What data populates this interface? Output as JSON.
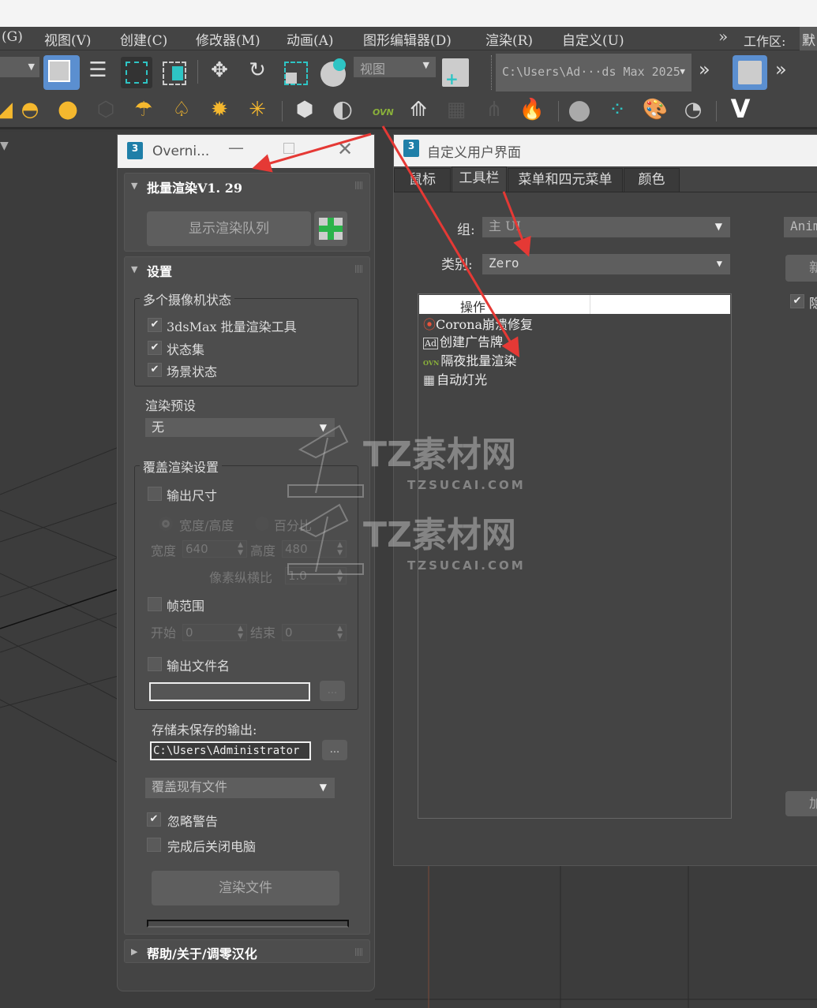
{
  "menubar": {
    "items": [
      "(G)",
      "视图(V)",
      "创建(C)",
      "修改器(M)",
      "动画(A)",
      "图形编辑器(D)",
      "渲染(R)",
      "自定义(U)"
    ],
    "overflow": "»",
    "workspace_label": "工作区:",
    "workspace_value": "默"
  },
  "toolbar": {
    "view_dropdown": "视图",
    "path_dropdown": "C:\\Users\\Ad···ds Max 2025",
    "overflow": "»",
    "ovn_label": "OVN"
  },
  "overnight": {
    "title": "Overni...",
    "rollout1": {
      "title": "批量渲染V1. 29",
      "show_queue": "显示渲染队列"
    },
    "rollout2": {
      "title": "设置",
      "camera_group": "多个摄像机状态",
      "checks": [
        {
          "label": "3dsMax 批量渲染工具",
          "checked": true
        },
        {
          "label": "状态集",
          "checked": true
        },
        {
          "label": "场景状态",
          "checked": true
        }
      ],
      "preset_label": "渲染预设",
      "preset_value": "无",
      "override_group": "覆盖渲染设置",
      "output_size": "输出尺寸",
      "radio_wh": "宽度/高度",
      "radio_pct": "百分比",
      "width_label": "宽度",
      "width_value": "640",
      "height_label": "高度",
      "height_value": "480",
      "aspect_label": "像素纵横比",
      "aspect_value": "1.0",
      "frame_range": "帧范围",
      "start_label": "开始",
      "start_value": "0",
      "end_label": "结束",
      "end_value": "0",
      "output_filename": "输出文件名",
      "filename_value": "",
      "browse": "...",
      "unsaved_label": "存储未保存的输出:",
      "unsaved_path": "C:\\Users\\Administrator",
      "overwrite": "覆盖现有文件",
      "ignore_warn": "忽略警告",
      "shutdown": "完成后关闭电脑",
      "render_button": "渲染文件",
      "progress": 0
    },
    "rollout3": {
      "title": "帮助/关于/调零汉化"
    }
  },
  "customize": {
    "title": "自定义用户界面",
    "tabs": [
      "鼠标",
      "工具栏",
      "菜单和四元菜单",
      "颜色"
    ],
    "active_tab": 1,
    "group_label": "组:",
    "group_value": "主 UI",
    "category_label": "类别:",
    "category_value": "Zero",
    "list_header": "操作",
    "actions": [
      "Corona崩溃修复",
      "创建广告牌",
      "隔夜批量渲染",
      "自动灯光"
    ],
    "right_dropdown": "Anim",
    "right_button": "新",
    "right_check": "隐",
    "right_bottom_button": "加"
  },
  "watermark": {
    "brand": "TZ素材网",
    "url": "TZSUCAI.COM"
  },
  "colors": {
    "accent": "#3c8fd6",
    "panel": "#444444",
    "annotation": "#e53935"
  }
}
